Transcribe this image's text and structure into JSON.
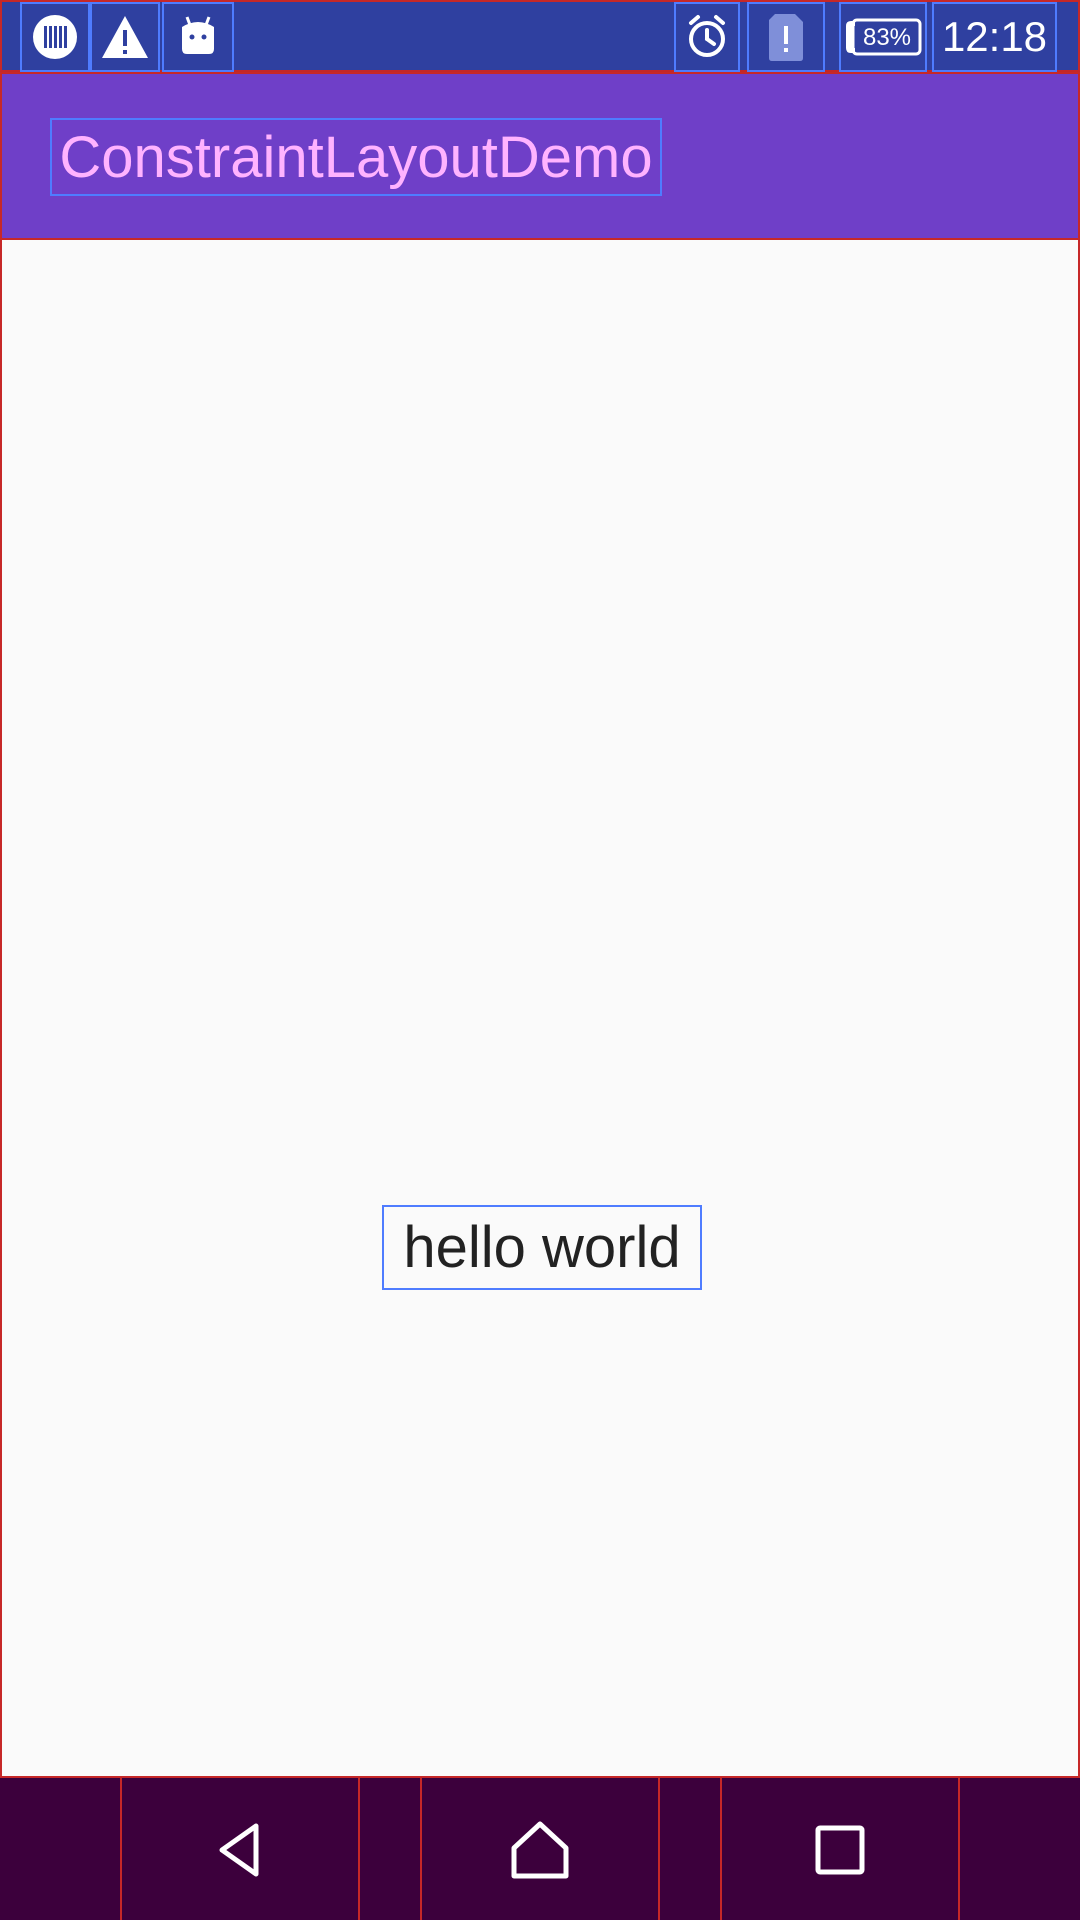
{
  "status_bar": {
    "battery_text": "83%",
    "time": "12:18",
    "left_icons": [
      "barcode-icon",
      "warning-icon",
      "android-icon"
    ],
    "right_icons": [
      "alarm-icon",
      "sim-error-icon",
      "battery-icon"
    ]
  },
  "app_bar": {
    "title": "ConstraintLayoutDemo",
    "background": "#6f3fc8",
    "title_color": "#ffb3ff"
  },
  "main": {
    "message": "hello world"
  },
  "nav_bar": {
    "buttons": [
      "back-icon",
      "home-icon",
      "recent-apps-icon"
    ],
    "background": "#3c003c"
  },
  "colors": {
    "status_bar": "#2f40a0",
    "content_background": "#fafafa",
    "layout_guides": "#4f7cff",
    "layout_bounds": "#c62828"
  }
}
